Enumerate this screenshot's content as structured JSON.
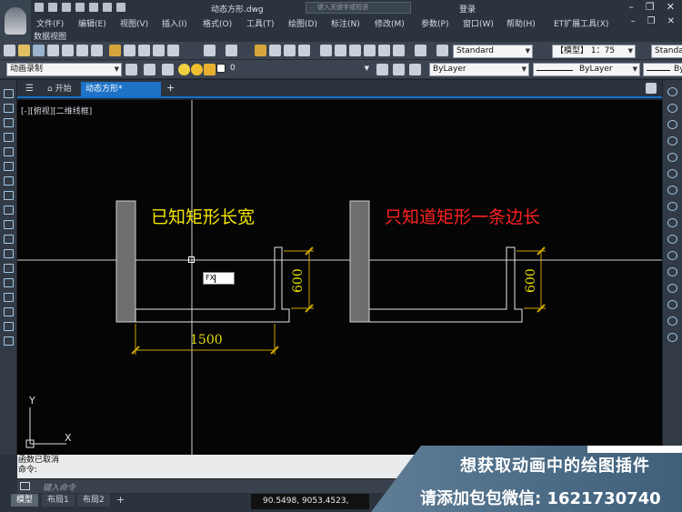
{
  "window": {
    "title": "动态方形.dwg",
    "search_placeholder": "键入关键字或短语",
    "login_label": "登录"
  },
  "menu": {
    "items": [
      "文件(F)",
      "编辑(E)",
      "视图(V)",
      "插入(I)",
      "格式(O)",
      "工具(T)",
      "绘图(D)",
      "标注(N)",
      "修改(M)",
      "参数(P)",
      "窗口(W)",
      "帮助(H)",
      "ET扩展工具(X)"
    ],
    "second_row": "数据视图"
  },
  "toolbar": {
    "text_style": "Standard",
    "model_scale": "【模型】 1：75",
    "dim_style": "Standa",
    "workspace": "动画录制",
    "layer": "0",
    "color": "ByLayer",
    "linetype": "ByLayer",
    "lineweight": "By"
  },
  "tabs": {
    "start": "开始",
    "active": "动态方形*",
    "add": "+"
  },
  "viewport": {
    "label": "[-][俯视][二维线框]"
  },
  "drawing": {
    "left_caption": "已知矩形长宽",
    "right_caption": "只知道矩形一条边长",
    "dim_width": "1500",
    "dim_height_left": "600",
    "dim_height_right": "600",
    "input_prompt": "FX",
    "ucs_x": "X",
    "ucs_y": "Y",
    "colors": {
      "caption_yellow": "#f3e600",
      "caption_red": "#ff2020",
      "dimension": "#c9a400",
      "crosshair": "#cfcfcf"
    }
  },
  "command": {
    "history_line1": "函数已取消",
    "history_line2": "命令:",
    "placeholder": "键入命令"
  },
  "status": {
    "tabs": [
      "模型",
      "布局1",
      "布局2"
    ],
    "add": "+",
    "coords": "90.5498, 9053.4523, 0.0000"
  },
  "promo": {
    "line1": "想获取动画中的绘图插件",
    "line2": "请添加包包微信: 1621730740"
  }
}
